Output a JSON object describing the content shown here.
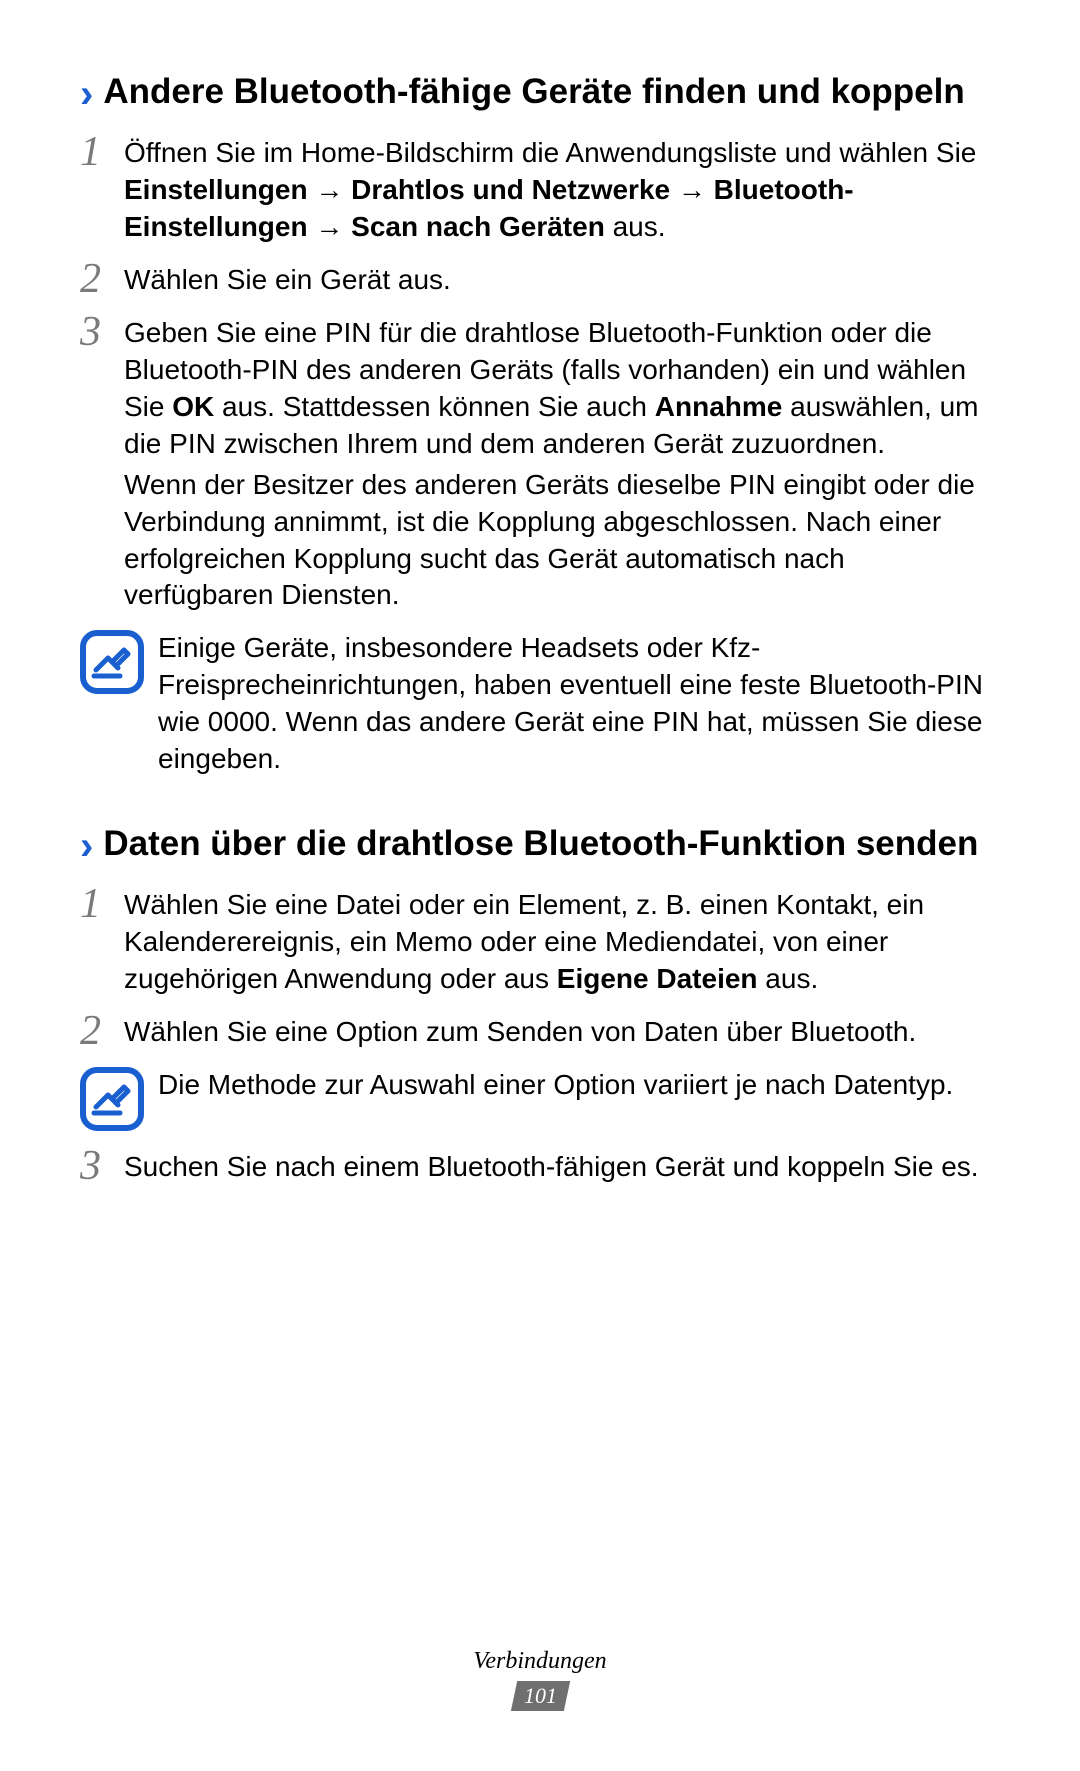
{
  "section1": {
    "heading": "Andere Bluetooth-fähige Geräte finden und koppeln",
    "step1": {
      "num": "1",
      "pre": "Öffnen Sie im Home-Bildschirm die Anwendungsliste und wählen Sie ",
      "b1": "Einstellungen",
      "arr1": " → ",
      "b2": "Drahtlos und Netzwerke",
      "arr2": " → ",
      "b3": "Bluetooth-Einstellungen",
      "arr3": " → ",
      "b4": "Scan nach Geräten",
      "post": " aus."
    },
    "step2": {
      "num": "2",
      "text": "Wählen Sie ein Gerät aus."
    },
    "step3": {
      "num": "3",
      "p1a": "Geben Sie eine PIN für die drahtlose Bluetooth-Funktion oder die Bluetooth-PIN des anderen Geräts (falls vorhanden) ein und wählen Sie ",
      "p1b1": "OK",
      "p1mid": " aus. Stattdessen können Sie auch ",
      "p1b2": "Annahme",
      "p1c": " auswählen, um die PIN zwischen Ihrem und dem anderen Gerät zuzuordnen.",
      "p2": "Wenn der Besitzer des anderen Geräts dieselbe PIN eingibt oder die Verbindung annimmt, ist die Kopplung abgeschlossen. Nach einer erfolgreichen Kopplung sucht das Gerät automatisch nach verfügbaren Diensten."
    },
    "note": "Einige Geräte, insbesondere Headsets oder Kfz-Freisprecheinrichtungen, haben eventuell eine feste Bluetooth-PIN wie 0000. Wenn das andere Gerät eine PIN hat, müssen Sie diese eingeben."
  },
  "section2": {
    "heading": "Daten über die drahtlose Bluetooth-Funktion senden",
    "step1": {
      "num": "1",
      "pre": "Wählen Sie eine Datei oder ein Element, z. B. einen Kontakt, ein Kalenderereignis, ein Memo oder eine Mediendatei, von einer zugehörigen Anwendung oder aus ",
      "b1": "Eigene Dateien",
      "post": " aus."
    },
    "step2": {
      "num": "2",
      "text": "Wählen Sie eine Option zum Senden von Daten über Bluetooth."
    },
    "note": "Die Methode zur Auswahl einer Option variiert je nach Datentyp.",
    "step3": {
      "num": "3",
      "text": "Suchen Sie nach einem Bluetooth-fähigen Gerät und koppeln Sie es."
    }
  },
  "footer": {
    "label": "Verbindungen",
    "page": "101"
  }
}
